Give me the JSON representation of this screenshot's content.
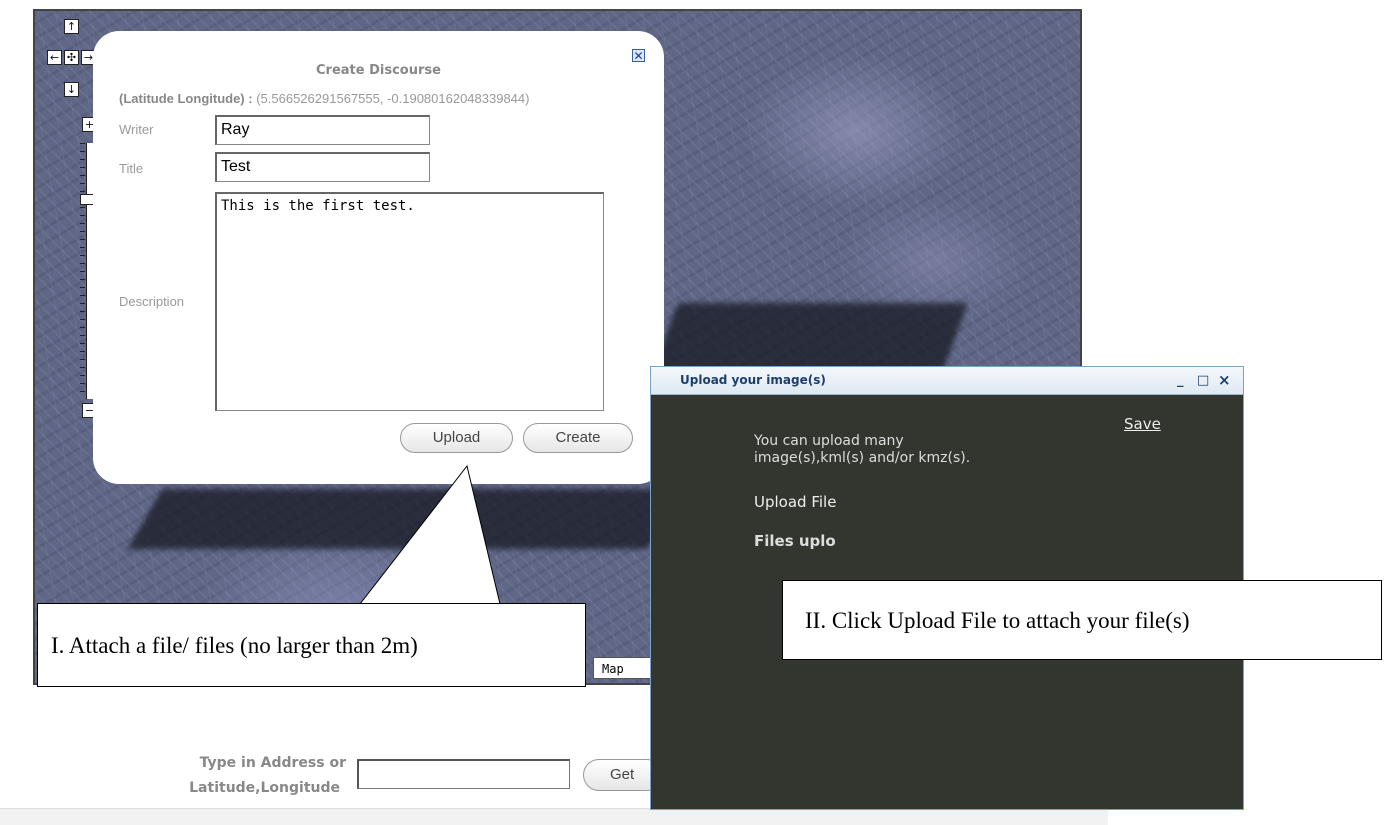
{
  "map": {
    "logo_text": "Map",
    "nav": {
      "up": "↑",
      "left": "←",
      "center": "✣",
      "right": "→",
      "down": "↓",
      "zoom_in": "+",
      "zoom_out": "−"
    }
  },
  "discourse": {
    "title": "Create Discourse",
    "coord_label": "(Latitude Longitude) :",
    "coord_value": "(5.566526291567555, -0.19080162048339844)",
    "writer_label": "Writer",
    "writer_value": "Ray",
    "title_label": "Title",
    "title_value": "Test",
    "description_label": "Description",
    "description_value": "This is the first test.",
    "upload_button": "Upload",
    "create_button": "Create",
    "close_icon": "close-icon"
  },
  "callouts": {
    "one": "I. Attach a file/ files (no larger than 2m)",
    "two": "II. Click Upload File to attach your file(s)"
  },
  "upload_dialog": {
    "title": "Upload your image(s)",
    "minimize": "_",
    "maximize": "□",
    "close": "×",
    "save_link": "Save",
    "info_line1": "You can upload many",
    "info_line2": "image(s),kml(s) and/or kmz(s).",
    "upload_file_link": "Upload File",
    "files_uploaded_label": "Files uplo"
  },
  "address": {
    "label_line1": "Type in Address or",
    "label_line2": "Latitude,Longitude",
    "input_value": "",
    "get_button": "Get"
  }
}
